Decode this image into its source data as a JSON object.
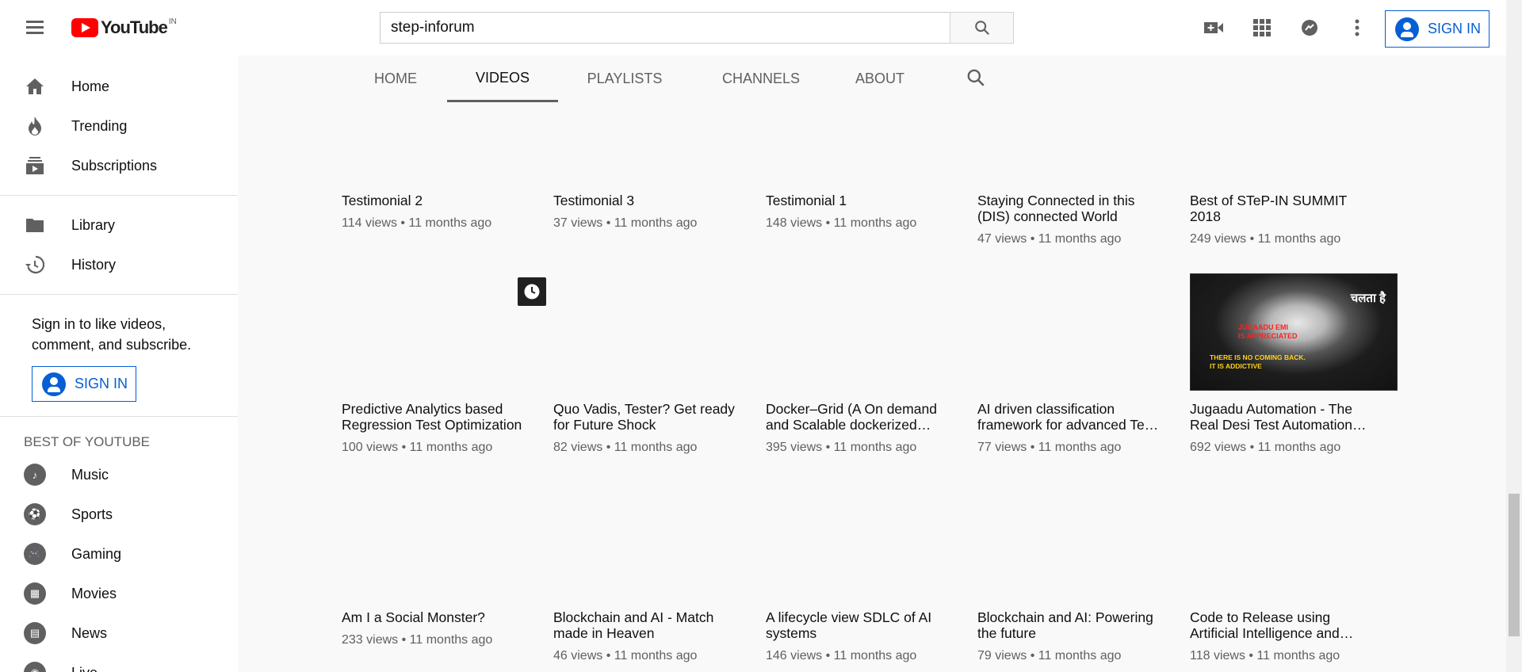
{
  "header": {
    "logo_text": "YouTube",
    "region": "IN",
    "search_value": "step-inforum",
    "signin_label": "SIGN IN"
  },
  "sidebar": {
    "main": [
      {
        "label": "Home",
        "icon": "home-icon"
      },
      {
        "label": "Trending",
        "icon": "trending-icon"
      },
      {
        "label": "Subscriptions",
        "icon": "subscriptions-icon"
      }
    ],
    "library": [
      {
        "label": "Library",
        "icon": "library-icon"
      },
      {
        "label": "History",
        "icon": "history-icon"
      }
    ],
    "signin_promo": "Sign in to like videos, comment, and subscribe.",
    "signin_label": "SIGN IN",
    "best_title": "BEST OF YOUTUBE",
    "best": [
      {
        "label": "Music",
        "icon": "music-icon"
      },
      {
        "label": "Sports",
        "icon": "sports-icon"
      },
      {
        "label": "Gaming",
        "icon": "gaming-icon"
      },
      {
        "label": "Movies",
        "icon": "movies-icon"
      },
      {
        "label": "News",
        "icon": "news-icon"
      },
      {
        "label": "Live",
        "icon": "live-icon"
      }
    ]
  },
  "tabs": [
    "HOME",
    "VIDEOS",
    "PLAYLISTS",
    "CHANNELS",
    "ABOUT"
  ],
  "active_tab": "VIDEOS",
  "thumbnail_text": {
    "hindi": "चलता है",
    "red": "JUGAADU EMI\nIS APPRECIATED",
    "yellow": "THERE IS NO COMING BACK.\nIT IS ADDICTIVE"
  },
  "videos": [
    {
      "title": "Testimonial 2",
      "views": "114 views",
      "age": "11 months ago"
    },
    {
      "title": "Testimonial 3",
      "views": "37 views",
      "age": "11 months ago"
    },
    {
      "title": "Testimonial 1",
      "views": "148 views",
      "age": "11 months ago"
    },
    {
      "title": "Staying Connected in this (DIS) connected World",
      "views": "47 views",
      "age": "11 months ago"
    },
    {
      "title": "Best of STeP-IN SUMMIT 2018",
      "views": "249 views",
      "age": "11 months ago"
    },
    {
      "title": "Predictive Analytics based Regression Test Optimization",
      "views": "100 views",
      "age": "11 months ago"
    },
    {
      "title": "Quo Vadis, Tester? Get ready for Future Shock",
      "views": "82 views",
      "age": "11 months ago"
    },
    {
      "title": "Docker–Grid (A On demand and Scalable dockerized Selenium Grid)",
      "views": "395 views",
      "age": "11 months ago"
    },
    {
      "title": "AI driven classification framework for advanced Test Coverage",
      "views": "77 views",
      "age": "11 months ago"
    },
    {
      "title": "Jugaadu Automation - The Real Desi Test Automation Framework",
      "views": "692 views",
      "age": "11 months ago"
    },
    {
      "title": "Am I a Social Monster?",
      "views": "233 views",
      "age": "11 months ago"
    },
    {
      "title": "Blockchain and AI - Match made in Heaven",
      "views": "46 views",
      "age": "11 months ago"
    },
    {
      "title": "A lifecycle view SDLC of AI systems",
      "views": "146 views",
      "age": "11 months ago"
    },
    {
      "title": "Blockchain and AI: Powering the future",
      "views": "79 views",
      "age": "11 months ago"
    },
    {
      "title": "Code to Release using Artificial Intelligence and Machine Learning",
      "views": "118 views",
      "age": "11 months ago"
    }
  ]
}
